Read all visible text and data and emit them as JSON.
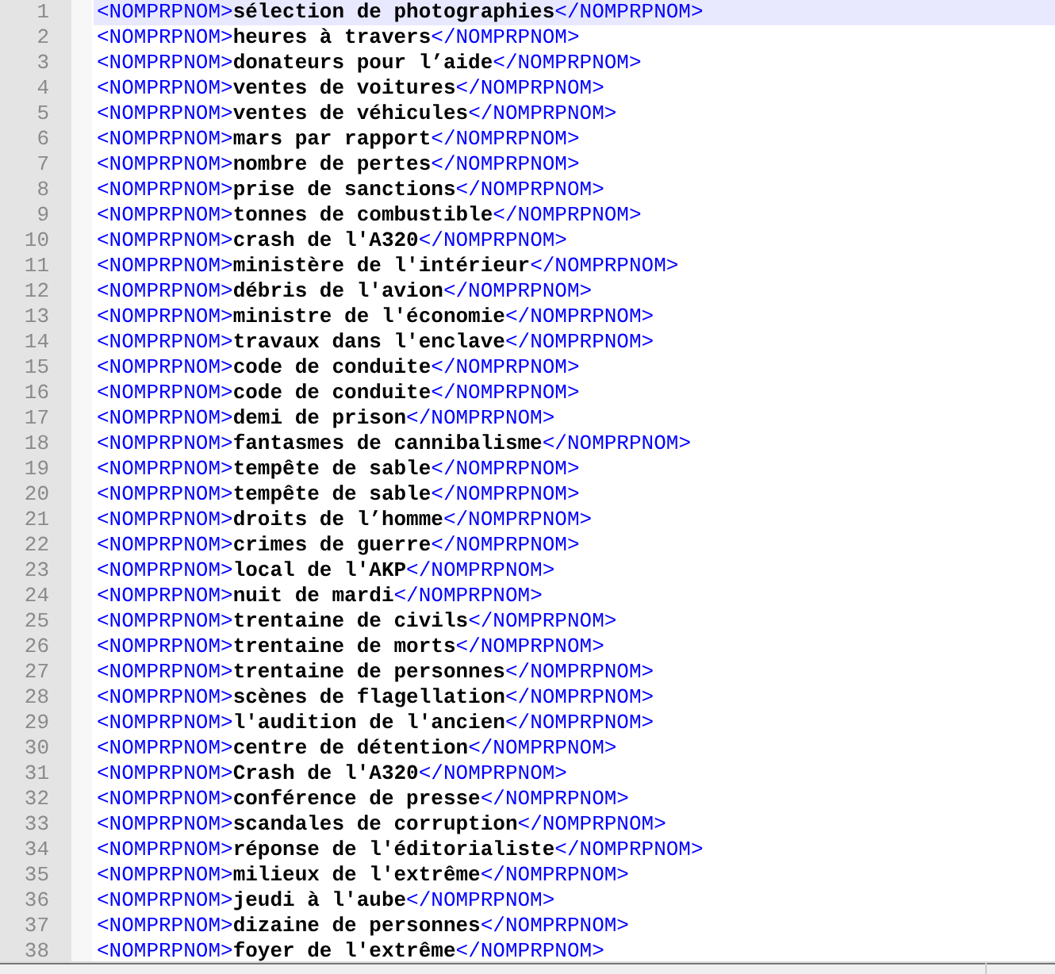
{
  "editor": {
    "lines": [
      {
        "number": "1",
        "open_tag": "<NOMPRPNOM>",
        "content": "sélection de photographies",
        "close_tag": "</NOMPRPNOM>",
        "current": true
      },
      {
        "number": "2",
        "open_tag": "<NOMPRPNOM>",
        "content": "heures à travers",
        "close_tag": "</NOMPRPNOM>",
        "current": false
      },
      {
        "number": "3",
        "open_tag": "<NOMPRPNOM>",
        "content": "donateurs pour l’aide",
        "close_tag": "</NOMPRPNOM>",
        "current": false
      },
      {
        "number": "4",
        "open_tag": "<NOMPRPNOM>",
        "content": "ventes de voitures",
        "close_tag": "</NOMPRPNOM>",
        "current": false
      },
      {
        "number": "5",
        "open_tag": "<NOMPRPNOM>",
        "content": "ventes de véhicules",
        "close_tag": "</NOMPRPNOM>",
        "current": false
      },
      {
        "number": "6",
        "open_tag": "<NOMPRPNOM>",
        "content": "mars par rapport",
        "close_tag": "</NOMPRPNOM>",
        "current": false
      },
      {
        "number": "7",
        "open_tag": "<NOMPRPNOM>",
        "content": "nombre de pertes",
        "close_tag": "</NOMPRPNOM>",
        "current": false
      },
      {
        "number": "8",
        "open_tag": "<NOMPRPNOM>",
        "content": "prise de sanctions",
        "close_tag": "</NOMPRPNOM>",
        "current": false
      },
      {
        "number": "9",
        "open_tag": "<NOMPRPNOM>",
        "content": "tonnes de combustible",
        "close_tag": "</NOMPRPNOM>",
        "current": false
      },
      {
        "number": "10",
        "open_tag": "<NOMPRPNOM>",
        "content": "crash de l'A320",
        "close_tag": "</NOMPRPNOM>",
        "current": false
      },
      {
        "number": "11",
        "open_tag": "<NOMPRPNOM>",
        "content": "ministère de l'intérieur",
        "close_tag": "</NOMPRPNOM>",
        "current": false
      },
      {
        "number": "12",
        "open_tag": "<NOMPRPNOM>",
        "content": "débris de l'avion",
        "close_tag": "</NOMPRPNOM>",
        "current": false
      },
      {
        "number": "13",
        "open_tag": "<NOMPRPNOM>",
        "content": "ministre de l'économie",
        "close_tag": "</NOMPRPNOM>",
        "current": false
      },
      {
        "number": "14",
        "open_tag": "<NOMPRPNOM>",
        "content": "travaux dans l'enclave",
        "close_tag": "</NOMPRPNOM>",
        "current": false
      },
      {
        "number": "15",
        "open_tag": "<NOMPRPNOM>",
        "content": "code de conduite",
        "close_tag": "</NOMPRPNOM>",
        "current": false
      },
      {
        "number": "16",
        "open_tag": "<NOMPRPNOM>",
        "content": "code de conduite",
        "close_tag": "</NOMPRPNOM>",
        "current": false
      },
      {
        "number": "17",
        "open_tag": "<NOMPRPNOM>",
        "content": "demi de prison",
        "close_tag": "</NOMPRPNOM>",
        "current": false
      },
      {
        "number": "18",
        "open_tag": "<NOMPRPNOM>",
        "content": "fantasmes de cannibalisme",
        "close_tag": "</NOMPRPNOM>",
        "current": false
      },
      {
        "number": "19",
        "open_tag": "<NOMPRPNOM>",
        "content": "tempête de sable",
        "close_tag": "</NOMPRPNOM>",
        "current": false
      },
      {
        "number": "20",
        "open_tag": "<NOMPRPNOM>",
        "content": "tempête de sable",
        "close_tag": "</NOMPRPNOM>",
        "current": false
      },
      {
        "number": "21",
        "open_tag": "<NOMPRPNOM>",
        "content": "droits de l’homme",
        "close_tag": "</NOMPRPNOM>",
        "current": false
      },
      {
        "number": "22",
        "open_tag": "<NOMPRPNOM>",
        "content": "crimes de guerre",
        "close_tag": "</NOMPRPNOM>",
        "current": false
      },
      {
        "number": "23",
        "open_tag": "<NOMPRPNOM>",
        "content": "local de l'AKP",
        "close_tag": "</NOMPRPNOM>",
        "current": false
      },
      {
        "number": "24",
        "open_tag": "<NOMPRPNOM>",
        "content": "nuit de mardi",
        "close_tag": "</NOMPRPNOM>",
        "current": false
      },
      {
        "number": "25",
        "open_tag": "<NOMPRPNOM>",
        "content": "trentaine de civils",
        "close_tag": "</NOMPRPNOM>",
        "current": false
      },
      {
        "number": "26",
        "open_tag": "<NOMPRPNOM>",
        "content": "trentaine de morts",
        "close_tag": "</NOMPRPNOM>",
        "current": false
      },
      {
        "number": "27",
        "open_tag": "<NOMPRPNOM>",
        "content": "trentaine de personnes",
        "close_tag": "</NOMPRPNOM>",
        "current": false
      },
      {
        "number": "28",
        "open_tag": "<NOMPRPNOM>",
        "content": "scènes de flagellation",
        "close_tag": "</NOMPRPNOM>",
        "current": false
      },
      {
        "number": "29",
        "open_tag": "<NOMPRPNOM>",
        "content": "l'audition de l'ancien",
        "close_tag": "</NOMPRPNOM>",
        "current": false
      },
      {
        "number": "30",
        "open_tag": "<NOMPRPNOM>",
        "content": "centre de détention",
        "close_tag": "</NOMPRPNOM>",
        "current": false
      },
      {
        "number": "31",
        "open_tag": "<NOMPRPNOM>",
        "content": "Crash de l'A320",
        "close_tag": "</NOMPRPNOM>",
        "current": false
      },
      {
        "number": "32",
        "open_tag": "<NOMPRPNOM>",
        "content": "conférence de presse",
        "close_tag": "</NOMPRPNOM>",
        "current": false
      },
      {
        "number": "33",
        "open_tag": "<NOMPRPNOM>",
        "content": "scandales de corruption",
        "close_tag": "</NOMPRPNOM>",
        "current": false
      },
      {
        "number": "34",
        "open_tag": "<NOMPRPNOM>",
        "content": "réponse de l'éditorialiste",
        "close_tag": "</NOMPRPNOM>",
        "current": false
      },
      {
        "number": "35",
        "open_tag": "<NOMPRPNOM>",
        "content": "milieux de l'extrême",
        "close_tag": "</NOMPRPNOM>",
        "current": false
      },
      {
        "number": "36",
        "open_tag": "<NOMPRPNOM>",
        "content": "jeudi à l'aube",
        "close_tag": "</NOMPRPNOM>",
        "current": false
      },
      {
        "number": "37",
        "open_tag": "<NOMPRPNOM>",
        "content": "dizaine de personnes",
        "close_tag": "</NOMPRPNOM>",
        "current": false
      },
      {
        "number": "38",
        "open_tag": "<NOMPRPNOM>",
        "content": "foyer de l'extrême",
        "close_tag": "</NOMPRPNOM>",
        "current": false
      }
    ]
  }
}
